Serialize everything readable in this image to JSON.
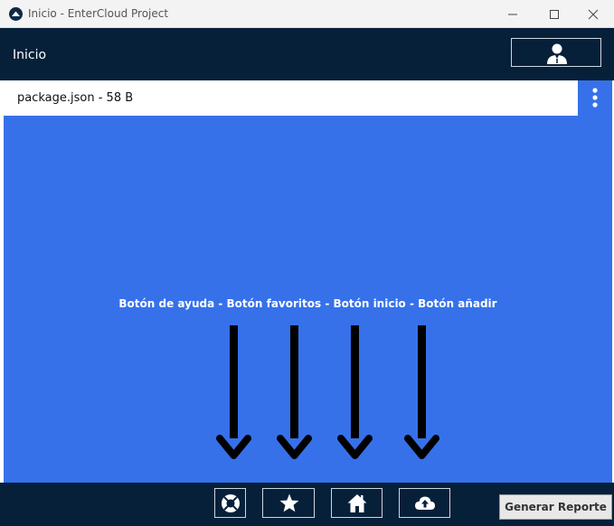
{
  "window": {
    "title": "Inicio - EnterCloud Project",
    "controls": [
      "minimize-icon",
      "maximize-icon",
      "close-icon"
    ]
  },
  "header": {
    "title": "Inicio",
    "profile_icon": "user-icon"
  },
  "file_bar": {
    "label": "package.json - 58 B",
    "menu_icon": "kebab-menu-icon"
  },
  "main": {
    "annotation": "Botón de ayuda - Botón favoritos - Botón inicio - Botón añadir"
  },
  "footer": {
    "nav": [
      {
        "name": "help",
        "icon": "lifebuoy-icon"
      },
      {
        "name": "favorites",
        "icon": "star-icon"
      },
      {
        "name": "home",
        "icon": "home-icon"
      },
      {
        "name": "add",
        "icon": "cloud-upload-icon"
      }
    ],
    "report_label": "Generar Reporte"
  },
  "colors": {
    "titlebar": "#f3f3f3",
    "header": "#06203a",
    "main": "#3671ea",
    "footer": "#06203a"
  }
}
